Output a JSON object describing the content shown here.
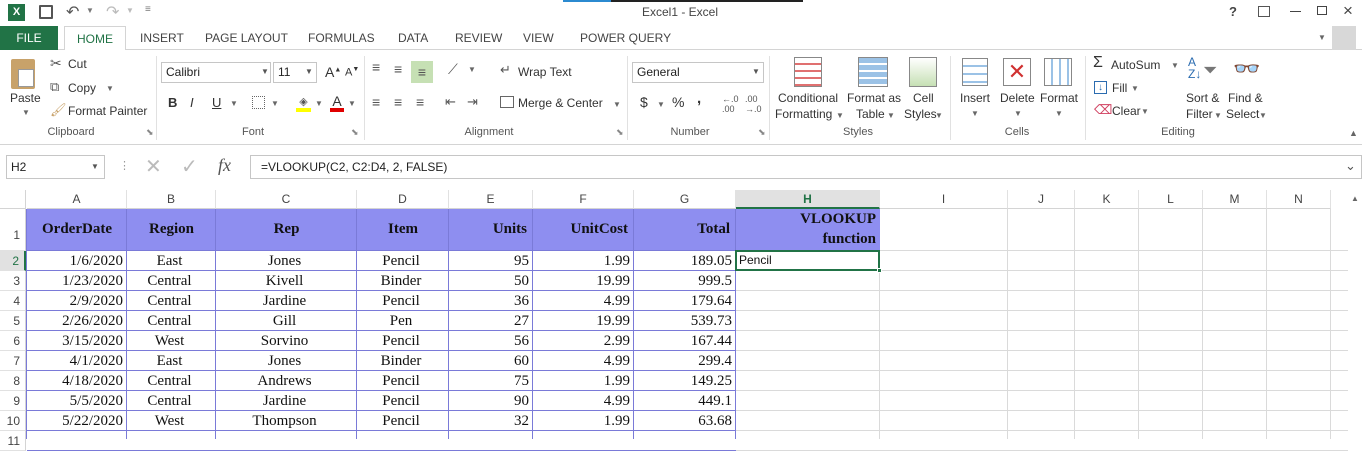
{
  "app": {
    "title": "Excel1 - Excel",
    "help": "?"
  },
  "tabs": {
    "file": "FILE",
    "home": "HOME",
    "insert": "INSERT",
    "page_layout": "PAGE LAYOUT",
    "formulas": "FORMULAS",
    "data": "DATA",
    "review": "REVIEW",
    "view": "VIEW",
    "power_query": "POWER QUERY"
  },
  "clipboard": {
    "paste": "Paste",
    "cut": "Cut",
    "copy": "Copy",
    "format_painter": "Format Painter",
    "label": "Clipboard"
  },
  "font": {
    "name": "Calibri",
    "size": "11",
    "bold": "B",
    "italic": "I",
    "underline": "U",
    "label": "Font"
  },
  "alignment": {
    "wrap_text": "Wrap Text",
    "merge_center": "Merge & Center",
    "label": "Alignment"
  },
  "number": {
    "format": "General",
    "currency": "$",
    "percent": "%",
    "comma": ",",
    "label": "Number"
  },
  "styles": {
    "conditional_1": "Conditional",
    "conditional_2": "Formatting",
    "format_table_1": "Format as",
    "format_table_2": "Table",
    "cell_styles_1": "Cell",
    "cell_styles_2": "Styles",
    "label": "Styles"
  },
  "cells": {
    "insert": "Insert",
    "delete": "Delete",
    "format": "Format",
    "label": "Cells"
  },
  "editing": {
    "autosum": "AutoSum",
    "fill": "Fill",
    "clear": "Clear",
    "sort_1": "Sort &",
    "sort_2": "Filter",
    "find_1": "Find &",
    "find_2": "Select",
    "label": "Editing"
  },
  "formula_bar": {
    "name_box": "H2",
    "fx": "fx",
    "formula": "=VLOOKUP(C2, C2:D4, 2, FALSE)"
  },
  "columns": [
    "A",
    "B",
    "C",
    "D",
    "E",
    "F",
    "G",
    "H",
    "I",
    "J",
    "K",
    "L",
    "M",
    "N"
  ],
  "rows": [
    "1",
    "2",
    "3",
    "4",
    "5",
    "6",
    "7",
    "8",
    "9",
    "10",
    "11"
  ],
  "headers": [
    "OrderDate",
    "Region",
    "Rep",
    "Item",
    "Units",
    "UnitCost",
    "Total"
  ],
  "h_header": {
    "line1": "VLOOKUP",
    "line2": "function"
  },
  "data": [
    [
      "1/6/2020",
      "East",
      "Jones",
      "Pencil",
      "95",
      "1.99",
      "189.05"
    ],
    [
      "1/23/2020",
      "Central",
      "Kivell",
      "Binder",
      "50",
      "19.99",
      "999.5"
    ],
    [
      "2/9/2020",
      "Central",
      "Jardine",
      "Pencil",
      "36",
      "4.99",
      "179.64"
    ],
    [
      "2/26/2020",
      "Central",
      "Gill",
      "Pen",
      "27",
      "19.99",
      "539.73"
    ],
    [
      "3/15/2020",
      "West",
      "Sorvino",
      "Pencil",
      "56",
      "2.99",
      "167.44"
    ],
    [
      "4/1/2020",
      "East",
      "Jones",
      "Binder",
      "60",
      "4.99",
      "299.4"
    ],
    [
      "4/18/2020",
      "Central",
      "Andrews",
      "Pencil",
      "75",
      "1.99",
      "149.25"
    ],
    [
      "5/5/2020",
      "Central",
      "Jardine",
      "Pencil",
      "90",
      "4.99",
      "449.1"
    ],
    [
      "5/22/2020",
      "West",
      "Thompson",
      "Pencil",
      "32",
      "1.99",
      "63.68"
    ]
  ],
  "active_cell_value": "Pencil",
  "colors": {
    "accent": "#217346",
    "header_fill": "#8e8ef0",
    "selection": "#217346"
  }
}
